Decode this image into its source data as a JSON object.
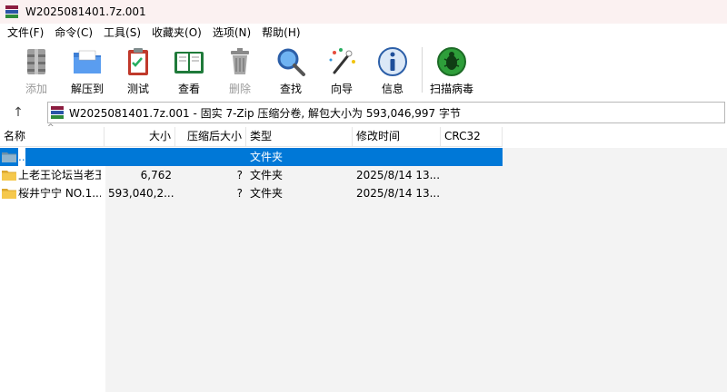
{
  "window": {
    "title": "W2025081401.7z.001"
  },
  "menu": {
    "items": [
      "文件(F)",
      "命令(C)",
      "工具(S)",
      "收藏夹(O)",
      "选项(N)",
      "帮助(H)"
    ]
  },
  "toolbar": {
    "buttons": [
      {
        "label": "添加",
        "icon": "add-archive-icon",
        "disabled": true
      },
      {
        "label": "解压到",
        "icon": "extract-folder-icon",
        "disabled": false
      },
      {
        "label": "测试",
        "icon": "test-clipboard-icon",
        "disabled": false
      },
      {
        "label": "查看",
        "icon": "view-book-icon",
        "disabled": false
      },
      {
        "label": "删除",
        "icon": "delete-trash-icon",
        "disabled": true
      },
      {
        "label": "查找",
        "icon": "find-magnifier-icon",
        "disabled": false
      },
      {
        "label": "向导",
        "icon": "wizard-wand-icon",
        "disabled": false
      },
      {
        "label": "信息",
        "icon": "info-icon",
        "disabled": false
      },
      {
        "label": "扫描病毒",
        "icon": "virus-scan-icon",
        "disabled": false
      }
    ]
  },
  "address": {
    "text": "W2025081401.7z.001 - 固实 7-Zip 压缩分卷, 解包大小为 593,046,997 字节"
  },
  "columns": {
    "name": "名称",
    "size": "大小",
    "packed": "压缩后大小",
    "type": "类型",
    "modified": "修改时间",
    "crc": "CRC32"
  },
  "files": [
    {
      "name": "..",
      "size": "",
      "packed": "",
      "type": "文件夹",
      "modified": "",
      "crc": "",
      "selected": true
    },
    {
      "name": "上老王论坛当老王",
      "size": "6,762",
      "packed": "?",
      "type": "文件夹",
      "modified": "2025/8/14 13...",
      "crc": "",
      "selected": false
    },
    {
      "name": "桜井宁宁 NO.1...",
      "size": "593,040,2...",
      "packed": "?",
      "type": "文件夹",
      "modified": "2025/8/14 13...",
      "crc": "",
      "selected": false
    }
  ],
  "colors": {
    "selection": "#0078d7",
    "title_bg": "#fbf1f1"
  }
}
